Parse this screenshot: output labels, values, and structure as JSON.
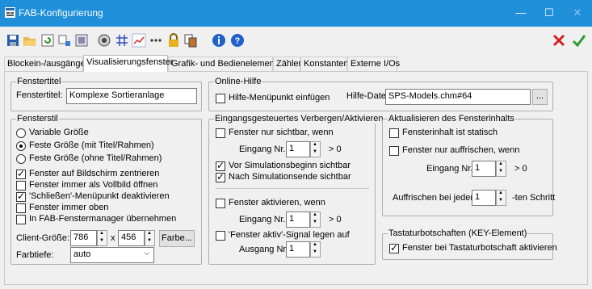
{
  "window": {
    "title": "FAB-Konfigurierung",
    "minimize": "—",
    "maximize": "☐",
    "close": "✕"
  },
  "toolbar": {
    "icons": [
      "save-icon",
      "open-folder-icon",
      "refresh-icon",
      "io-icon",
      "image-icon",
      "component-icon",
      "grid-icon",
      "chart-icon",
      "more-dots-icon",
      "lock-icon",
      "copy-icon",
      "info-icon",
      "help-icon"
    ],
    "cancel_color": "#d42020",
    "ok_color": "#2e9a2e"
  },
  "tabs": [
    "Blockein-/ausgänge",
    "Visualisierungsfenster",
    "Grafik- und Bedienelemente",
    "Zähler",
    "Konstanten",
    "Externe I/Os"
  ],
  "fenstertitel": {
    "group": "Fenstertitel",
    "label": "Fenstertitel:",
    "value": "Komplexe Sortieranlage"
  },
  "onlinehilfe": {
    "group": "Online-Hilfe",
    "menu_item": "Hilfe-Menüpunkt einfügen",
    "file_label": "Hilfe-Datei:",
    "file_value": "SPS-Models.chm#64",
    "browse": "..."
  },
  "fensterstil": {
    "group": "Fensterstil",
    "variable": "Variable Größe",
    "fixed_frame": "Feste Größe (mit Titel/Rahmen)",
    "fixed_noframe": "Feste Größe (ohne Titel/Rahmen)",
    "center": "Fenster auf Bildschirm zentrieren",
    "fullscreen": "Fenster immer als Vollbild öffnen",
    "close_menu": "'Schließen'-Menüpunkt deaktivieren",
    "on_top": "Fenster immer oben",
    "fab_manager": "In FAB-Fenstermanager übernehmen",
    "client_label": "Client-Größe:",
    "width": "786",
    "x": "x",
    "height": "456",
    "color_btn": "Farbe...",
    "depth_label": "Farbtiefe:",
    "depth_value": "auto"
  },
  "eingang": {
    "group": "Eingangsgesteuertes Verbergen/Aktivieren",
    "visible_if": "Fenster nur sichtbar, wenn",
    "input_label": "Eingang Nr.",
    "input_value": "1",
    "gt0": "> 0",
    "sim_start": "Vor Simulationsbeginn sichtbar",
    "sim_end": "Nach Simulationsende sichtbar",
    "activate_if": "Fenster aktivieren, wenn",
    "input2_value": "1",
    "gt0_2": "> 0",
    "signal": "'Fenster aktiv'-Signal legen auf",
    "output_label": "Ausgang Nr.",
    "output_value": "1"
  },
  "aktualisieren": {
    "group": "Aktualisieren des Fensterinhalts",
    "static": "Fensterinhalt ist statisch",
    "refresh_if": "Fenster nur auffrischen, wenn",
    "input_label": "Eingang Nr.",
    "input_value": "1",
    "gt0": "> 0",
    "every_label": "Auffrischen bei jedem",
    "every_value": "1",
    "step_label": "-ten Schritt"
  },
  "tastatur": {
    "group": "Tastaturbotschaften (KEY-Element)",
    "activate": "Fenster bei Tastaturbotschaft aktivieren"
  }
}
